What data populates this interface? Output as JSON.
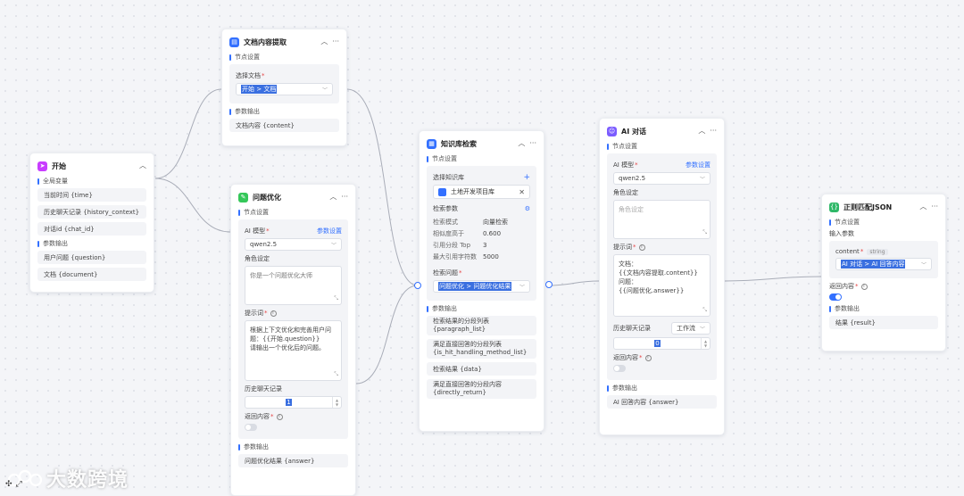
{
  "nodes": {
    "start": {
      "title": "开始",
      "sec_globals": "全局变量",
      "globals": [
        "当前时间 {time}",
        "历史聊天记录 {history_context}",
        "对话id {chat_id}"
      ],
      "sec_output": "参数输出",
      "outputs": [
        "用户问题 {question}",
        "文档 {document}"
      ]
    },
    "doc_extract": {
      "title": "文档内容提取",
      "sec_settings": "节点设置",
      "select_label": "选择文档",
      "select_value": "开始 > 文档",
      "sec_output": "参数输出",
      "output": "文档内容 {content}"
    },
    "question_opt": {
      "title": "问题优化",
      "sec_settings": "节点设置",
      "model_label": "AI 模型",
      "model_link": "参数设置",
      "model_value": "qwen2.5",
      "role_label": "角色设定",
      "role_value": "你是一个问题优化大师",
      "prompt_label": "提示词",
      "prompt_value": "根据上下文优化和完善用户问\n题：{{开始.question}}\n请输出一个优化后的问题。",
      "history_label": "历史聊天记录",
      "history_value": "1",
      "return_label": "返回内容",
      "sec_output": "参数输出",
      "output": "问题优化结果 {answer}"
    },
    "kb_search": {
      "title": "知识库检索",
      "sec_settings": "节点设置",
      "kb_label": "选择知识库",
      "kb_add": "+",
      "kb_name": "土地开发项目库",
      "params_label": "检索参数",
      "params": [
        {
          "k": "检索模式",
          "v": "向量检索"
        },
        {
          "k": "相似度高于",
          "v": "0.600"
        },
        {
          "k": "引用分段 Top",
          "v": "3"
        },
        {
          "k": "最大引用字符数",
          "v": "5000"
        }
      ],
      "question_label": "检索问题",
      "question_value": "问题优化 > 问题优化结果",
      "sec_output": "参数输出",
      "outputs": [
        "检索结果的分段列表\n{paragraph_list}",
        "满足直接回答的分段列表\n{is_hit_handling_method_list}",
        "检索结果 {data}",
        "满足直接回答的分段内容\n{directly_return}"
      ]
    },
    "ai_chat": {
      "title": "AI 对话",
      "sec_settings": "节点设置",
      "model_label": "AI 模型",
      "model_link": "参数设置",
      "model_value": "qwen2.5",
      "role_label": "角色设定",
      "role_placeholder": "角色设定",
      "prompt_label": "提示词",
      "prompt_value": "文档：\n{{文档内容提取.content}}\n问题：\n{{问题优化.answer}}",
      "history_label": "历史聊天记录",
      "history_mode": "工作流",
      "history_value": "0",
      "return_label": "返回内容",
      "sec_output": "参数输出",
      "output": "AI 回答内容 {answer}"
    },
    "regex_json": {
      "title": "正则匹配JSON",
      "sec_settings": "节点设置",
      "input_label": "输入参数",
      "content_label": "content",
      "content_type": "string",
      "content_value": "AI 对话 > AI 回答内容",
      "return_label": "返回内容",
      "sec_output": "参数输出",
      "output": "结果 {result}"
    }
  },
  "watermark": "大数跨境",
  "icons": {
    "start": "cursor-icon",
    "doc_extract": "document-icon",
    "question_opt": "chat-optimize-icon",
    "kb_search": "knowledge-base-icon",
    "ai_chat": "ai-chat-icon",
    "regex_json": "json-icon"
  },
  "colors": {
    "accent": "#3370ff",
    "start_icon": "#c83dff",
    "doc_icon": "#3370ff",
    "opt_icon": "#34c759",
    "kb_icon": "#3370ff",
    "ai_icon": "#7b5cff",
    "json_icon": "#2fb868"
  }
}
